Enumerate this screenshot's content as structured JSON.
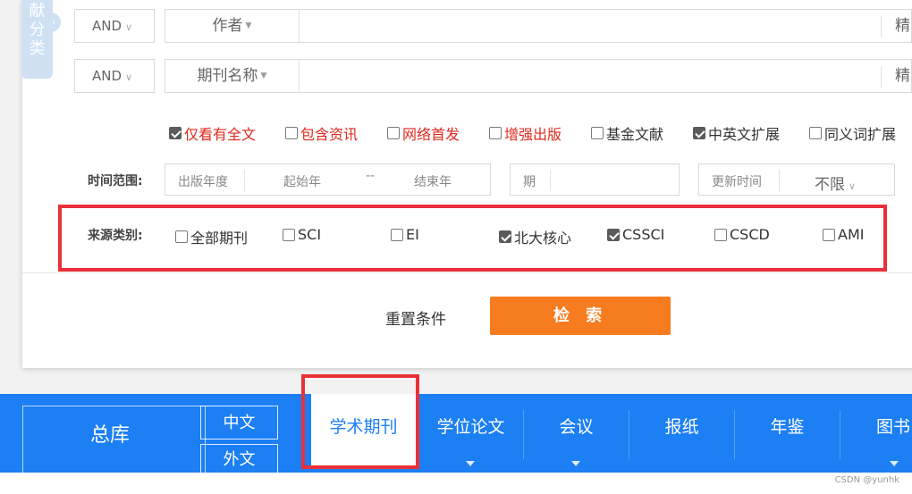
{
  "sidebar_tab": {
    "chars": [
      "献",
      "分",
      "类"
    ],
    "toggle": "›"
  },
  "rows": [
    {
      "logic": "AND",
      "field": "作者",
      "precise": "精"
    },
    {
      "logic": "AND",
      "field": "期刊名称",
      "precise": "精"
    }
  ],
  "options": [
    {
      "label": "仅看有全文",
      "checked": true,
      "color": "red"
    },
    {
      "label": "包含资讯",
      "checked": false,
      "color": "red"
    },
    {
      "label": "网络首发",
      "checked": false,
      "color": "red"
    },
    {
      "label": "增强出版",
      "checked": false,
      "color": "red"
    },
    {
      "label": "基金文献",
      "checked": false,
      "color": "dark"
    },
    {
      "label": "中英文扩展",
      "checked": true,
      "color": "dark"
    },
    {
      "label": "同义词扩展",
      "checked": false,
      "color": "dark"
    }
  ],
  "time": {
    "label": "时间范围:",
    "year_label": "出版年度",
    "start_placeholder": "起始年",
    "dash": "--",
    "end_placeholder": "结束年",
    "issue_label": "期",
    "update_label": "更新时间",
    "update_value": "不限"
  },
  "source": {
    "label": "来源类别:",
    "items": [
      {
        "label": "全部期刊",
        "checked": false
      },
      {
        "label": "SCI",
        "checked": false
      },
      {
        "label": "EI",
        "checked": false
      },
      {
        "label": "北大核心",
        "checked": true
      },
      {
        "label": "CSSCI",
        "checked": true
      },
      {
        "label": "CSCD",
        "checked": false
      },
      {
        "label": "AMI",
        "checked": false
      }
    ]
  },
  "actions": {
    "reset": "重置条件",
    "search": "检 索"
  },
  "nav": {
    "zongku": "总库",
    "zhongwen": "中文",
    "waiwen": "外文",
    "items": [
      "学术期刊",
      "学位论文",
      "会议",
      "报纸",
      "年鉴",
      "图书"
    ]
  },
  "watermark": "CSDN @yunhk",
  "colors": {
    "accent_orange": "#f77c1f",
    "nav_blue": "#1c7ff3",
    "highlight_red": "#e8313a",
    "option_red": "#e0281e"
  }
}
